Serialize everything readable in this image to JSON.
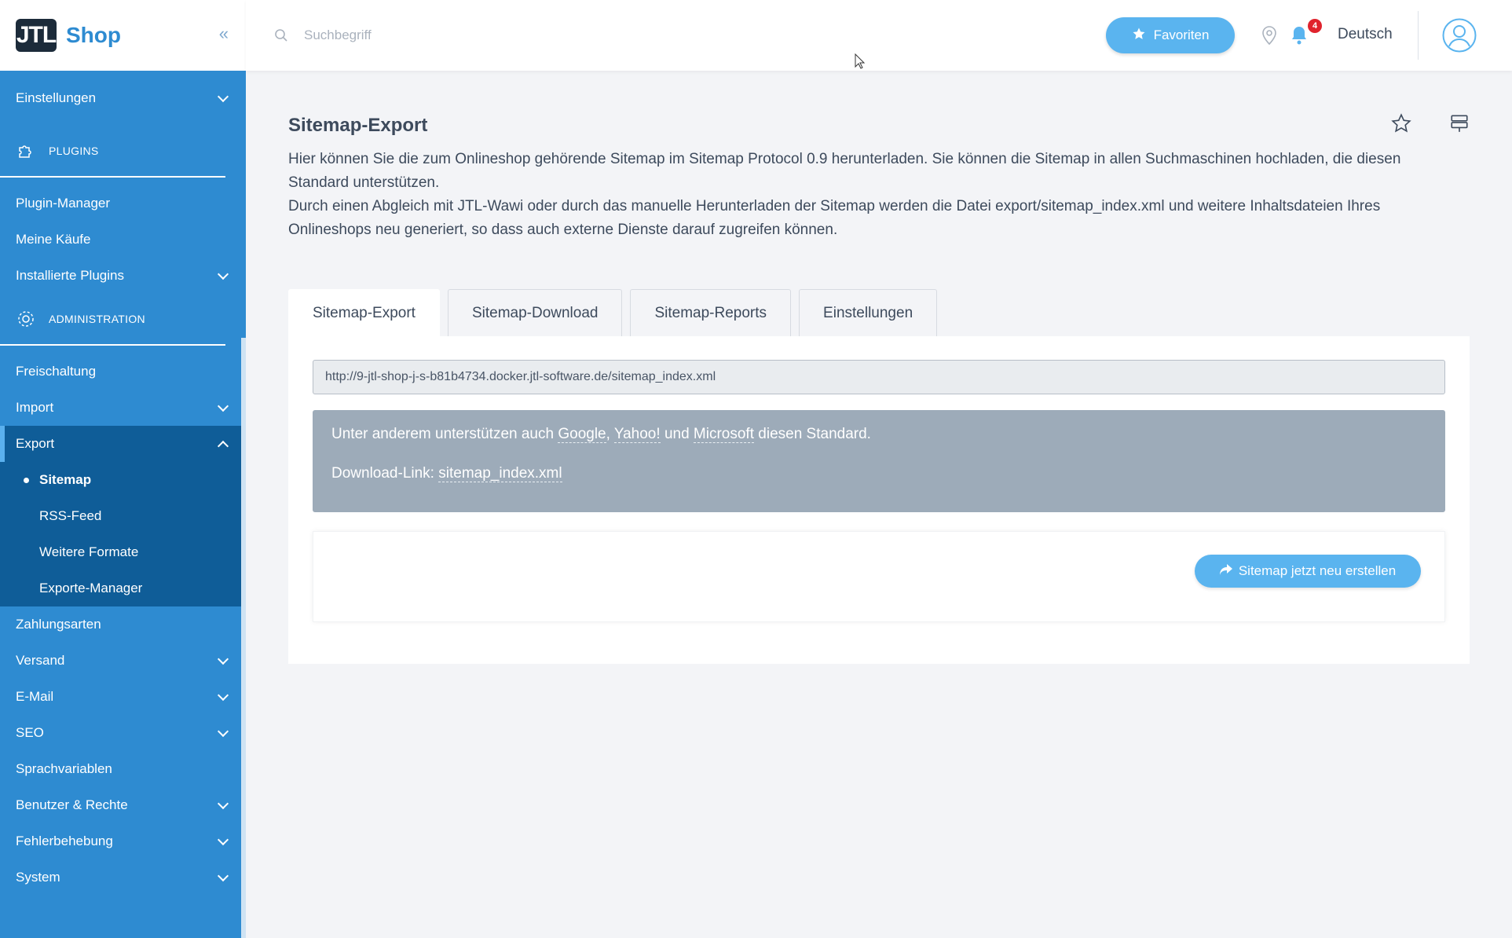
{
  "brand": {
    "logo": "JTL",
    "name": "Shop"
  },
  "sidebar": {
    "collapse_icon": "«",
    "top_items": [
      {
        "label": "Einstellungen",
        "expandable": true
      }
    ],
    "plugins_section": "PLUGINS",
    "plugin_items": [
      {
        "label": "Plugin-Manager"
      },
      {
        "label": "Meine Käufe"
      },
      {
        "label": "Installierte Plugins",
        "expandable": true
      }
    ],
    "admin_section": "ADMINISTRATION",
    "admin_items_before": [
      {
        "label": "Freischaltung"
      },
      {
        "label": "Import",
        "expandable": true
      }
    ],
    "export": {
      "label": "Export",
      "subitems": [
        "Sitemap",
        "RSS-Feed",
        "Weitere Formate",
        "Exporte-Manager"
      ]
    },
    "admin_items_after": [
      {
        "label": "Zahlungsarten"
      },
      {
        "label": "Versand"
      },
      {
        "label": "E-Mail"
      },
      {
        "label": "SEO"
      },
      {
        "label": "Sprachvariablen"
      },
      {
        "label": "Benutzer & Rechte"
      },
      {
        "label": "Fehlerbehebung"
      },
      {
        "label": "System"
      }
    ]
  },
  "header": {
    "search_placeholder": "Suchbegriff",
    "favorites_label": "Favoriten",
    "notification_count": "4",
    "language": "Deutsch"
  },
  "page": {
    "title": "Sitemap-Export",
    "description_1": "Hier können Sie die zum Onlineshop gehörende Sitemap im Sitemap Protocol 0.9 herunterladen. Sie können die Sitemap in allen Suchmaschinen hochladen, die diesen Standard unterstützen.",
    "description_2": "Durch einen Abgleich mit JTL-Wawi oder durch das manuelle Herunterladen der Sitemap werden die Datei export/sitemap_index.xml und weitere Inhaltsdateien Ihres Onlineshops neu generiert, so dass auch externe Dienste darauf zugreifen können.",
    "tabs": [
      "Sitemap-Export",
      "Sitemap-Download",
      "Sitemap-Reports",
      "Einstellungen"
    ],
    "url_value": "http://9-jtl-shop-j-s-b81b4734.docker.jtl-software.de/sitemap_index.xml",
    "info": {
      "prefix": "Unter anderem unterstützen auch",
      "google": "Google",
      "yahoo": "Yahoo!",
      "und": "und",
      "microsoft": "Microsoft",
      "suffix": "diesen Standard.",
      "download_label": "Download-Link:",
      "download_link": "sitemap_index.xml"
    },
    "regenerate_label": "Sitemap jetzt neu erstellen"
  },
  "colors": {
    "sidebar": "#2e8bd1",
    "sidebar_active": "#0f5d98",
    "accent": "#5ab4ef",
    "info_box": "#9dabb9"
  }
}
